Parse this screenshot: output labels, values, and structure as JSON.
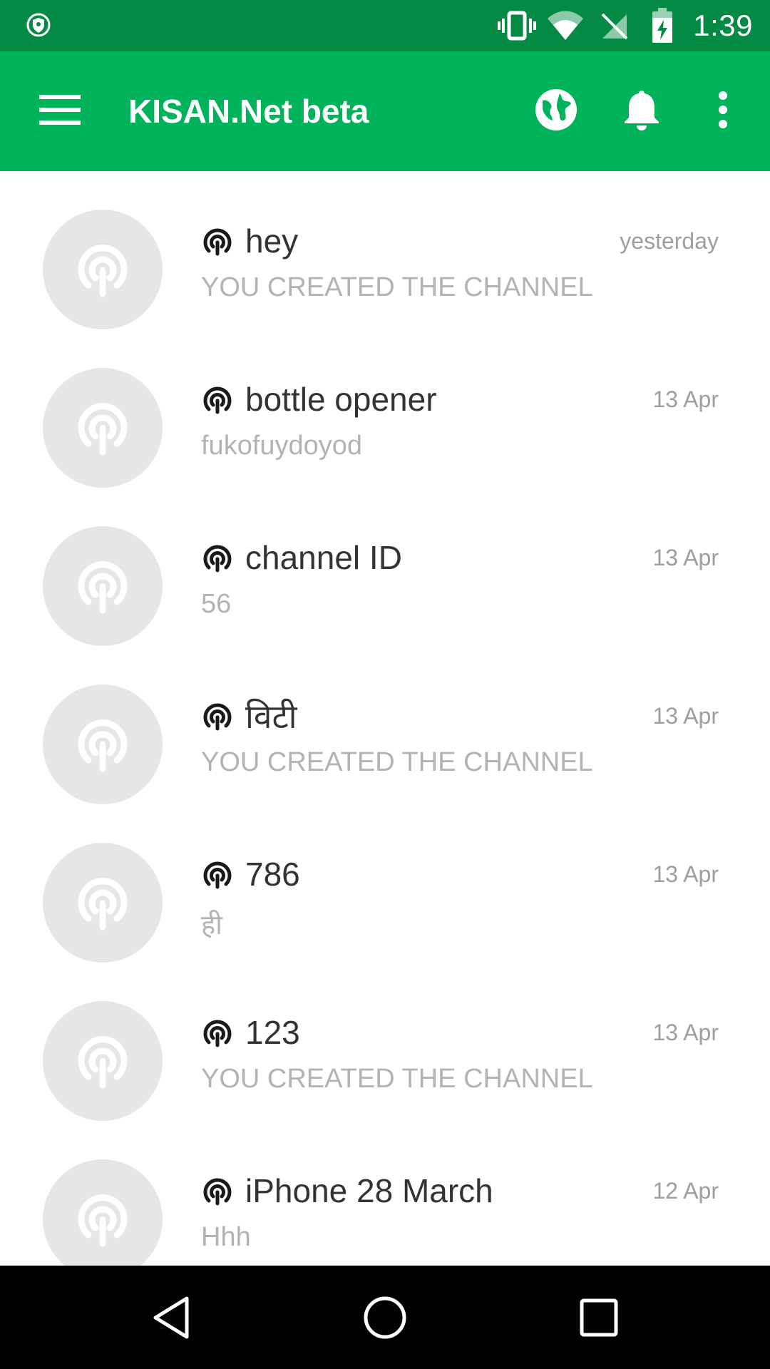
{
  "status_bar": {
    "time": "1:39",
    "icons": [
      "vpn-shield-icon",
      "vibrate-icon",
      "wifi-icon",
      "no-sim-icon",
      "battery-charging-icon"
    ]
  },
  "app_bar": {
    "title": "KISAN.Net beta",
    "icons": [
      "menu-icon",
      "globe-icon",
      "bell-icon",
      "more-vert-icon"
    ]
  },
  "channels": [
    {
      "title": "hey",
      "subtitle": "YOU CREATED THE CHANNEL",
      "time": "yesterday"
    },
    {
      "title": "bottle opener",
      "subtitle": "fukofuydoyod",
      "time": "13 Apr"
    },
    {
      "title": "channel ID",
      "subtitle": "56",
      "time": "13 Apr"
    },
    {
      "title": "विटी",
      "subtitle": "YOU CREATED THE CHANNEL",
      "time": "13 Apr"
    },
    {
      "title": "786",
      "subtitle": "ही",
      "time": "13 Apr"
    },
    {
      "title": "123",
      "subtitle": "YOU CREATED THE CHANNEL",
      "time": "13 Apr"
    },
    {
      "title": "iPhone 28 March",
      "subtitle": "Hhh",
      "time": "12 Apr"
    }
  ],
  "colors": {
    "status_bar": "#058a44",
    "app_bar": "#00b35a",
    "avatar_bg": "#e6e6e6",
    "title_text": "#333333",
    "subtitle_text": "#b3b3b3"
  }
}
